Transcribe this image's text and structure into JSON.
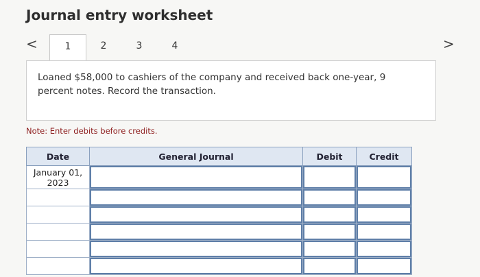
{
  "header": {
    "title": "Journal entry worksheet"
  },
  "nav": {
    "prev": "<",
    "next": ">"
  },
  "tabs": [
    {
      "label": "1",
      "active": true
    },
    {
      "label": "2",
      "active": false
    },
    {
      "label": "3",
      "active": false
    },
    {
      "label": "4",
      "active": false
    }
  ],
  "question": {
    "text": "Loaned $58,000 to cashiers of the company and received back one-year, 9 percent notes. Record the transaction."
  },
  "note": "Note: Enter debits before credits.",
  "table": {
    "headers": {
      "date": "Date",
      "general_journal": "General Journal",
      "debit": "Debit",
      "credit": "Credit"
    },
    "rows": [
      {
        "date": "January 01, 2023",
        "general_journal": "",
        "debit": "",
        "credit": ""
      },
      {
        "date": "",
        "general_journal": "",
        "debit": "",
        "credit": ""
      },
      {
        "date": "",
        "general_journal": "",
        "debit": "",
        "credit": ""
      },
      {
        "date": "",
        "general_journal": "",
        "debit": "",
        "credit": ""
      },
      {
        "date": "",
        "general_journal": "",
        "debit": "",
        "credit": ""
      },
      {
        "date": "",
        "general_journal": "",
        "debit": "",
        "credit": ""
      }
    ]
  },
  "colors": {
    "header_bg": "#dfe7f2",
    "field_border": "#5f7fa8",
    "note_text": "#8b1a1a"
  }
}
